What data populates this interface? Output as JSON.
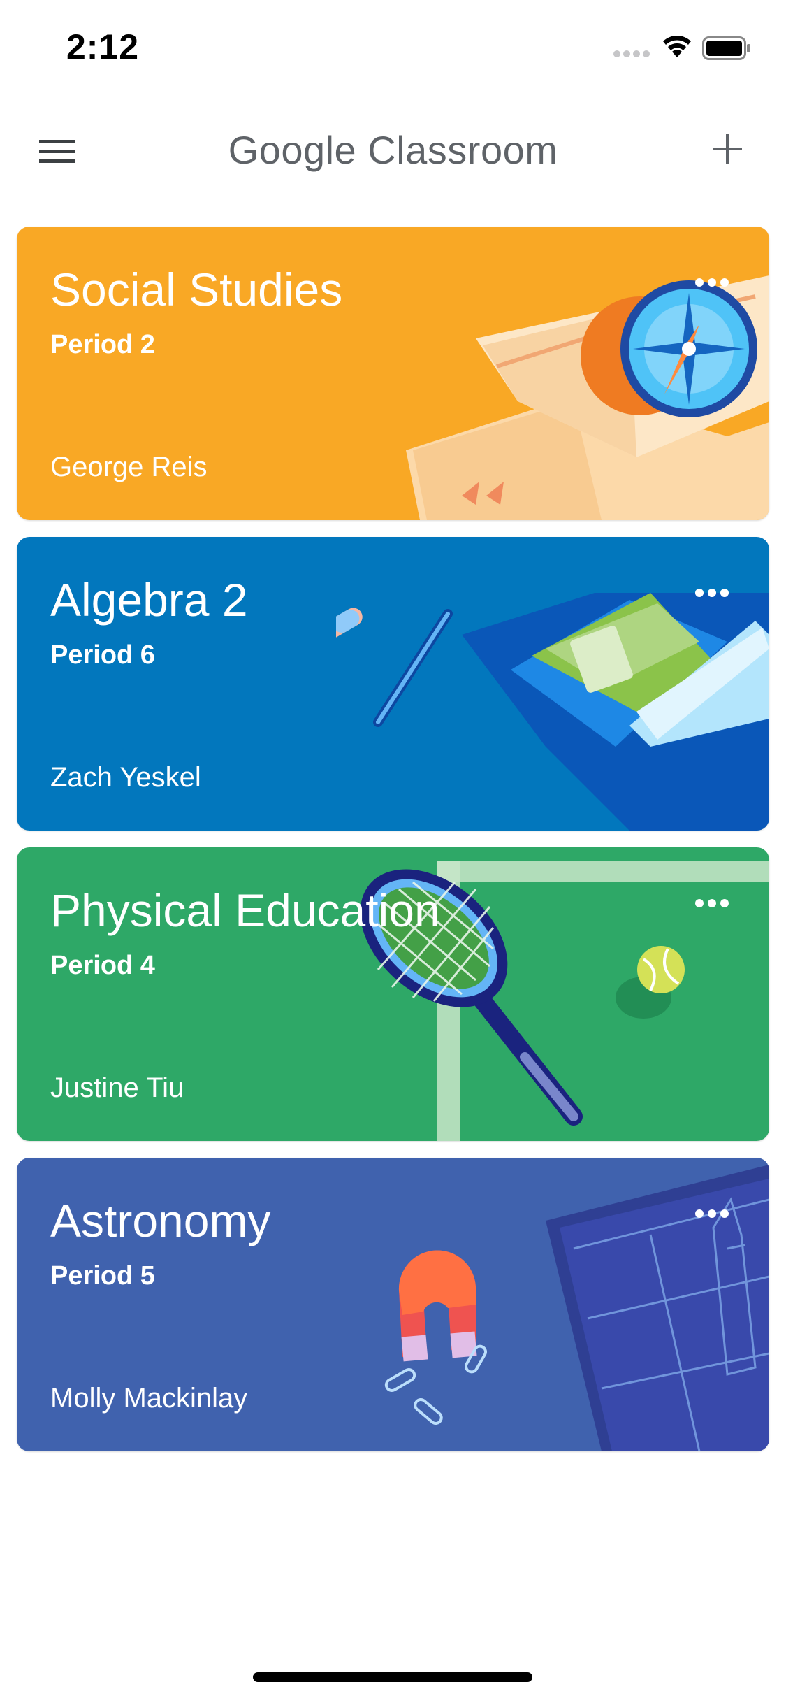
{
  "status_bar": {
    "time": "2:12"
  },
  "app_bar": {
    "title": "Google Classroom",
    "menu_icon": "hamburger-menu-icon",
    "add_icon": "plus-icon"
  },
  "classes": [
    {
      "title": "Social Studies",
      "section": "Period 2",
      "teacher": "George Reis",
      "color": "#F9A825",
      "illustration": "compass-map-illustration"
    },
    {
      "title": "Algebra 2",
      "section": "Period 6",
      "teacher": "Zach Yeskel",
      "color": "#0277BD",
      "illustration": "backpack-pen-illustration"
    },
    {
      "title": "Physical Education",
      "section": "Period 4",
      "teacher": "Justine Tiu",
      "color": "#2EA867",
      "illustration": "tennis-racket-illustration"
    },
    {
      "title": "Astronomy",
      "section": "Period 5",
      "teacher": "Molly Mackinlay",
      "color": "#4062AE",
      "illustration": "magnet-rocket-blueprint-illustration"
    }
  ]
}
